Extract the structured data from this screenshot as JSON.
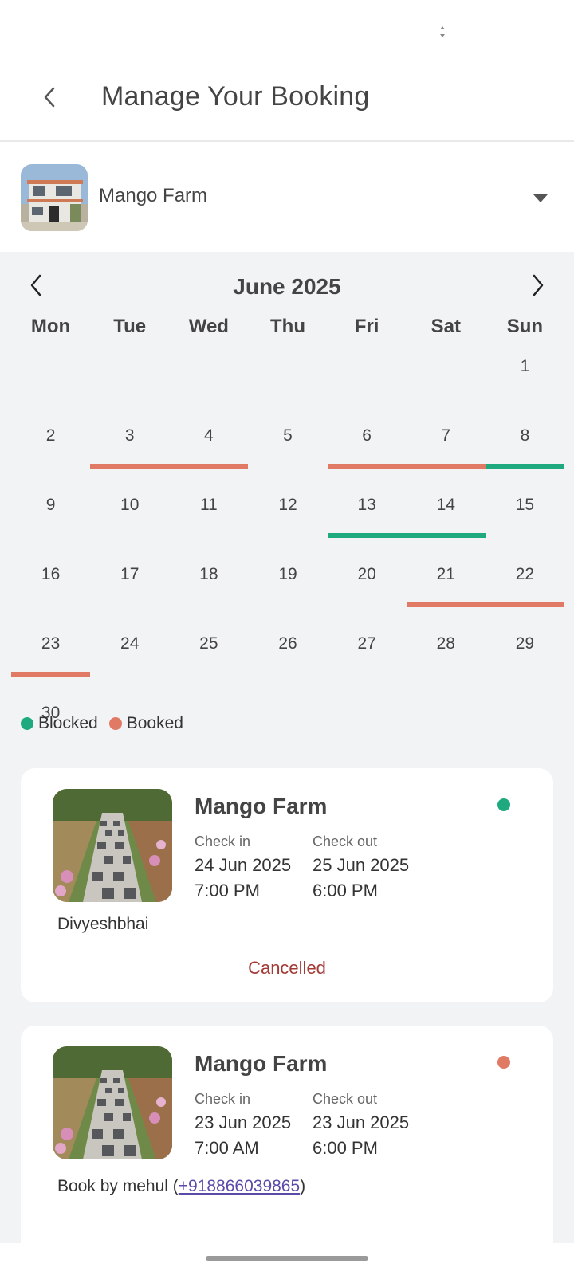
{
  "header": {
    "title": "Manage Your Booking",
    "back_icon": "chevron-left-icon"
  },
  "farm_selector": {
    "name": "Mango Farm",
    "dropdown_icon": "caret-down-icon"
  },
  "calendar": {
    "month_label": "June 2025",
    "weekdays": [
      "Mon",
      "Tue",
      "Wed",
      "Thu",
      "Fri",
      "Sat",
      "Sun"
    ],
    "colors": {
      "booked": "#e07a65",
      "blocked": "#1eaa7e"
    },
    "legend": {
      "blocked": "Blocked",
      "booked": "Booked"
    },
    "days": [
      {
        "d": "1",
        "bar": null
      },
      {
        "d": "2",
        "bar": null
      },
      {
        "d": "3",
        "bar": "booked"
      },
      {
        "d": "4",
        "bar": "booked"
      },
      {
        "d": "5",
        "bar": null
      },
      {
        "d": "6",
        "bar": "booked"
      },
      {
        "d": "7",
        "bar": "booked"
      },
      {
        "d": "8",
        "bar": "blocked"
      },
      {
        "d": "9",
        "bar": null
      },
      {
        "d": "10",
        "bar": null
      },
      {
        "d": "11",
        "bar": null
      },
      {
        "d": "12",
        "bar": null
      },
      {
        "d": "13",
        "bar": "blocked"
      },
      {
        "d": "14",
        "bar": "blocked"
      },
      {
        "d": "15",
        "bar": null
      },
      {
        "d": "16",
        "bar": null
      },
      {
        "d": "17",
        "bar": null
      },
      {
        "d": "18",
        "bar": null
      },
      {
        "d": "19",
        "bar": null
      },
      {
        "d": "20",
        "bar": null
      },
      {
        "d": "21",
        "bar": "booked"
      },
      {
        "d": "22",
        "bar": "booked"
      },
      {
        "d": "23",
        "bar": "booked"
      },
      {
        "d": "24",
        "bar": null
      },
      {
        "d": "25",
        "bar": null
      },
      {
        "d": "26",
        "bar": null
      },
      {
        "d": "27",
        "bar": null
      },
      {
        "d": "28",
        "bar": null
      },
      {
        "d": "29",
        "bar": null
      },
      {
        "d": "30",
        "bar": null
      }
    ]
  },
  "bookings": [
    {
      "farm": "Mango Farm",
      "status_color": "#1eaa7e",
      "check_in_label": "Check in",
      "check_in_date": "24 Jun 2025",
      "check_in_time": "7:00 PM",
      "check_out_label": "Check out",
      "check_out_date": "25 Jun 2025",
      "check_out_time": "6:00 PM",
      "guest": "Divyeshbhai",
      "status": "Cancelled"
    },
    {
      "farm": "Mango Farm",
      "status_color": "#e07a65",
      "check_in_label": "Check in",
      "check_in_date": "23 Jun 2025",
      "check_in_time": "7:00 AM",
      "check_out_label": "Check out",
      "check_out_date": "23 Jun 2025",
      "check_out_time": "6:00 PM",
      "guest_prefix": "Book by mehul (",
      "phone": "+918866039865",
      "guest_suffix": ")"
    }
  ]
}
